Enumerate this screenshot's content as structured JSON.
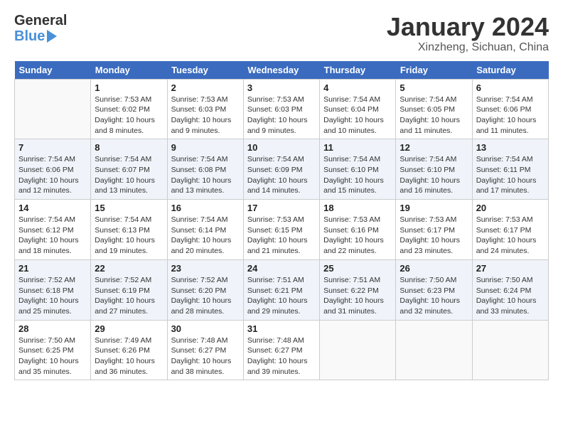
{
  "header": {
    "logo_general": "General",
    "logo_blue": "Blue",
    "month_title": "January 2024",
    "location": "Xinzheng, Sichuan, China"
  },
  "days_of_week": [
    "Sunday",
    "Monday",
    "Tuesday",
    "Wednesday",
    "Thursday",
    "Friday",
    "Saturday"
  ],
  "weeks": [
    [
      {
        "day": "",
        "info": ""
      },
      {
        "day": "1",
        "info": "Sunrise: 7:53 AM\nSunset: 6:02 PM\nDaylight: 10 hours\nand 8 minutes."
      },
      {
        "day": "2",
        "info": "Sunrise: 7:53 AM\nSunset: 6:03 PM\nDaylight: 10 hours\nand 9 minutes."
      },
      {
        "day": "3",
        "info": "Sunrise: 7:53 AM\nSunset: 6:03 PM\nDaylight: 10 hours\nand 9 minutes."
      },
      {
        "day": "4",
        "info": "Sunrise: 7:54 AM\nSunset: 6:04 PM\nDaylight: 10 hours\nand 10 minutes."
      },
      {
        "day": "5",
        "info": "Sunrise: 7:54 AM\nSunset: 6:05 PM\nDaylight: 10 hours\nand 11 minutes."
      },
      {
        "day": "6",
        "info": "Sunrise: 7:54 AM\nSunset: 6:06 PM\nDaylight: 10 hours\nand 11 minutes."
      }
    ],
    [
      {
        "day": "7",
        "info": "Sunrise: 7:54 AM\nSunset: 6:06 PM\nDaylight: 10 hours\nand 12 minutes."
      },
      {
        "day": "8",
        "info": "Sunrise: 7:54 AM\nSunset: 6:07 PM\nDaylight: 10 hours\nand 13 minutes."
      },
      {
        "day": "9",
        "info": "Sunrise: 7:54 AM\nSunset: 6:08 PM\nDaylight: 10 hours\nand 13 minutes."
      },
      {
        "day": "10",
        "info": "Sunrise: 7:54 AM\nSunset: 6:09 PM\nDaylight: 10 hours\nand 14 minutes."
      },
      {
        "day": "11",
        "info": "Sunrise: 7:54 AM\nSunset: 6:10 PM\nDaylight: 10 hours\nand 15 minutes."
      },
      {
        "day": "12",
        "info": "Sunrise: 7:54 AM\nSunset: 6:10 PM\nDaylight: 10 hours\nand 16 minutes."
      },
      {
        "day": "13",
        "info": "Sunrise: 7:54 AM\nSunset: 6:11 PM\nDaylight: 10 hours\nand 17 minutes."
      }
    ],
    [
      {
        "day": "14",
        "info": "Sunrise: 7:54 AM\nSunset: 6:12 PM\nDaylight: 10 hours\nand 18 minutes."
      },
      {
        "day": "15",
        "info": "Sunrise: 7:54 AM\nSunset: 6:13 PM\nDaylight: 10 hours\nand 19 minutes."
      },
      {
        "day": "16",
        "info": "Sunrise: 7:54 AM\nSunset: 6:14 PM\nDaylight: 10 hours\nand 20 minutes."
      },
      {
        "day": "17",
        "info": "Sunrise: 7:53 AM\nSunset: 6:15 PM\nDaylight: 10 hours\nand 21 minutes."
      },
      {
        "day": "18",
        "info": "Sunrise: 7:53 AM\nSunset: 6:16 PM\nDaylight: 10 hours\nand 22 minutes."
      },
      {
        "day": "19",
        "info": "Sunrise: 7:53 AM\nSunset: 6:17 PM\nDaylight: 10 hours\nand 23 minutes."
      },
      {
        "day": "20",
        "info": "Sunrise: 7:53 AM\nSunset: 6:17 PM\nDaylight: 10 hours\nand 24 minutes."
      }
    ],
    [
      {
        "day": "21",
        "info": "Sunrise: 7:52 AM\nSunset: 6:18 PM\nDaylight: 10 hours\nand 25 minutes."
      },
      {
        "day": "22",
        "info": "Sunrise: 7:52 AM\nSunset: 6:19 PM\nDaylight: 10 hours\nand 27 minutes."
      },
      {
        "day": "23",
        "info": "Sunrise: 7:52 AM\nSunset: 6:20 PM\nDaylight: 10 hours\nand 28 minutes."
      },
      {
        "day": "24",
        "info": "Sunrise: 7:51 AM\nSunset: 6:21 PM\nDaylight: 10 hours\nand 29 minutes."
      },
      {
        "day": "25",
        "info": "Sunrise: 7:51 AM\nSunset: 6:22 PM\nDaylight: 10 hours\nand 31 minutes."
      },
      {
        "day": "26",
        "info": "Sunrise: 7:50 AM\nSunset: 6:23 PM\nDaylight: 10 hours\nand 32 minutes."
      },
      {
        "day": "27",
        "info": "Sunrise: 7:50 AM\nSunset: 6:24 PM\nDaylight: 10 hours\nand 33 minutes."
      }
    ],
    [
      {
        "day": "28",
        "info": "Sunrise: 7:50 AM\nSunset: 6:25 PM\nDaylight: 10 hours\nand 35 minutes."
      },
      {
        "day": "29",
        "info": "Sunrise: 7:49 AM\nSunset: 6:26 PM\nDaylight: 10 hours\nand 36 minutes."
      },
      {
        "day": "30",
        "info": "Sunrise: 7:48 AM\nSunset: 6:27 PM\nDaylight: 10 hours\nand 38 minutes."
      },
      {
        "day": "31",
        "info": "Sunrise: 7:48 AM\nSunset: 6:27 PM\nDaylight: 10 hours\nand 39 minutes."
      },
      {
        "day": "",
        "info": ""
      },
      {
        "day": "",
        "info": ""
      },
      {
        "day": "",
        "info": ""
      }
    ]
  ]
}
